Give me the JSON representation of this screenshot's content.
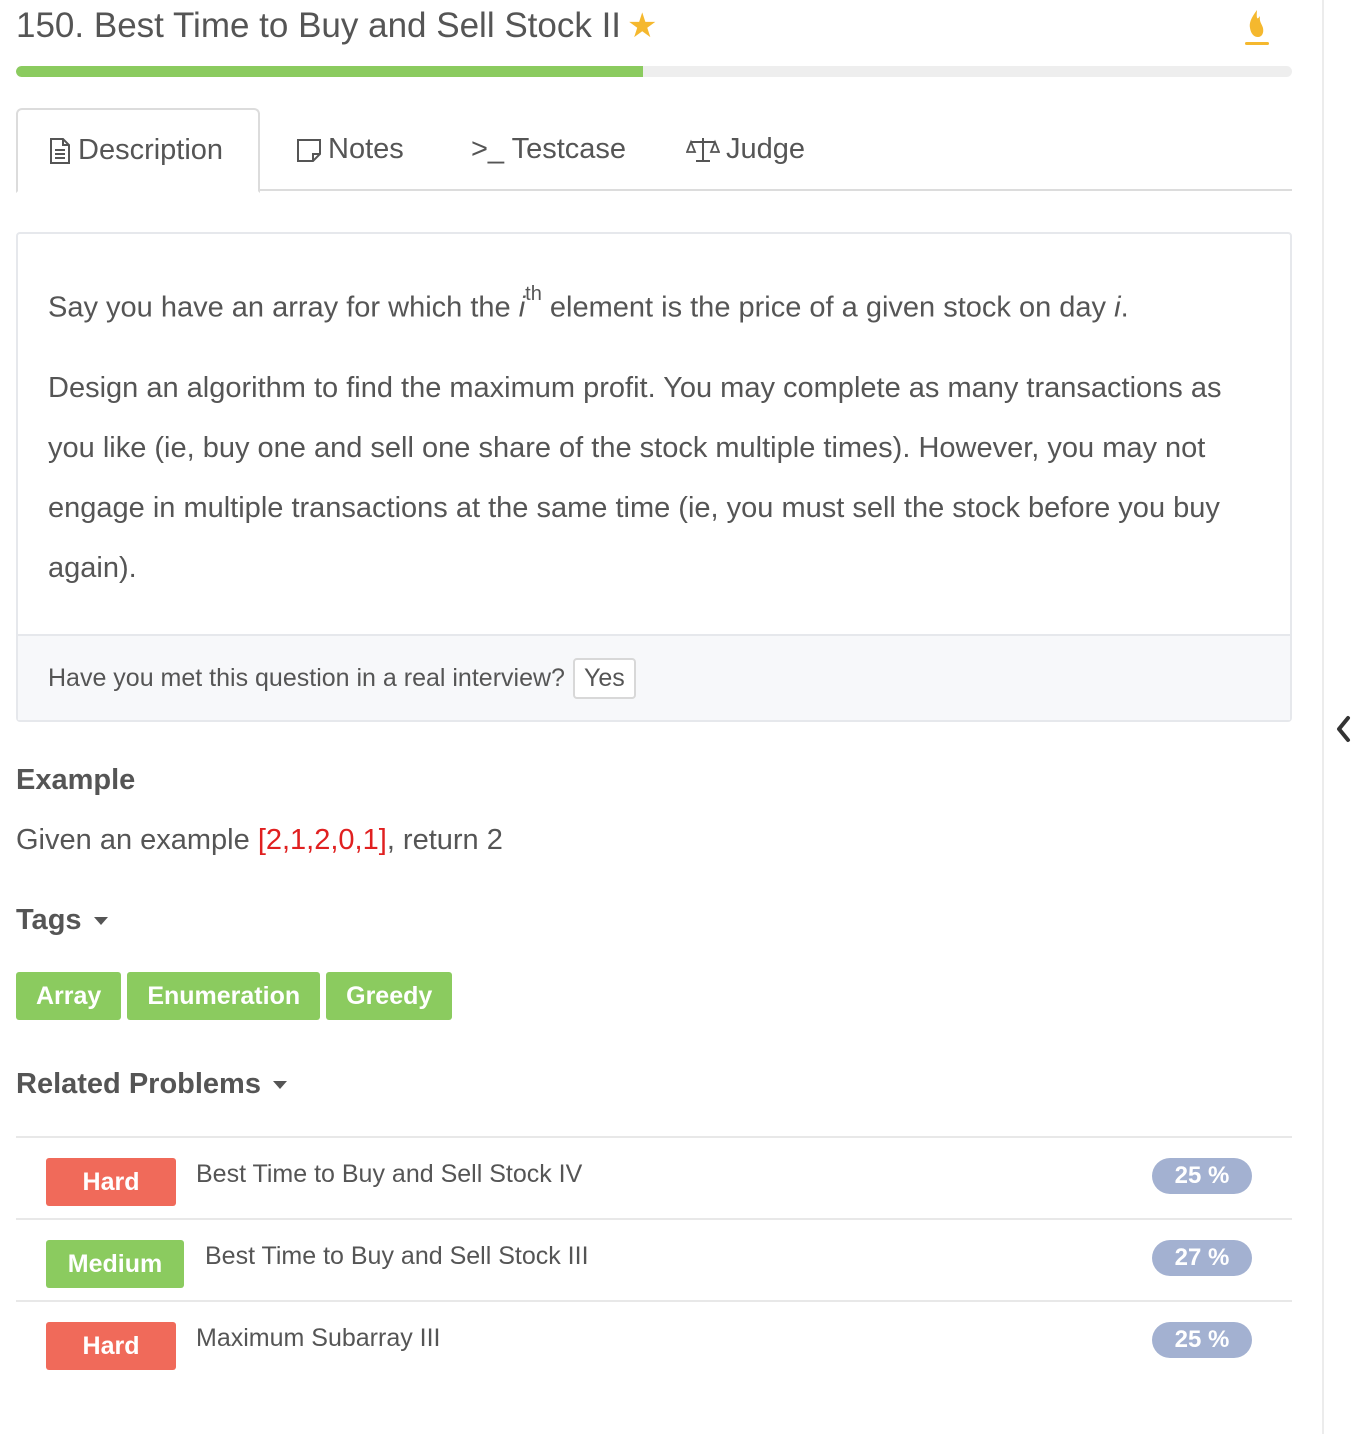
{
  "header": {
    "title": "150. Best Time to Buy and Sell Stock II",
    "progress_fraction": 0.491
  },
  "tabs": [
    {
      "label": "Description"
    },
    {
      "label": "Notes"
    },
    {
      "label": ">_ Testcase"
    },
    {
      "label": "Judge"
    }
  ],
  "description": {
    "p1_before": "Say you have an array for which the ",
    "p1_var": "i",
    "p1_sup": "th",
    "p1_middle": " element is the price of a given stock on day ",
    "p1_var2": "i",
    "p1_end": ".",
    "p2": "Design an algorithm to find the maximum profit. You may complete as many transactions as you like (ie, buy one and sell one share of the stock multiple times). However, you may not engage in multiple transactions at the same time (ie, you must sell the stock before you buy again).",
    "interview_question": "Have you met this question in a real interview?",
    "yes_label": "Yes"
  },
  "example": {
    "heading": "Example",
    "text_before": "Given an example ",
    "array": "[2,1,2,0,1]",
    "text_after": ", return 2"
  },
  "tags": {
    "heading": "Tags",
    "items": [
      "Array",
      "Enumeration",
      "Greedy"
    ]
  },
  "related": {
    "heading": "Related Problems",
    "items": [
      {
        "difficulty": "Hard",
        "name": "Best Time to Buy and Sell Stock IV",
        "rate": "25 %"
      },
      {
        "difficulty": "Medium",
        "name": "Best Time to Buy and Sell Stock III",
        "rate": "27 %"
      },
      {
        "difficulty": "Hard",
        "name": "Maximum Subarray III",
        "rate": "25 %"
      }
    ]
  },
  "colors": {
    "accent_green": "#8bcb5f",
    "hard_red": "#f06a5a",
    "rate_blue": "#a3b1d1",
    "star": "#f5b82e",
    "example_red": "#e02020"
  }
}
